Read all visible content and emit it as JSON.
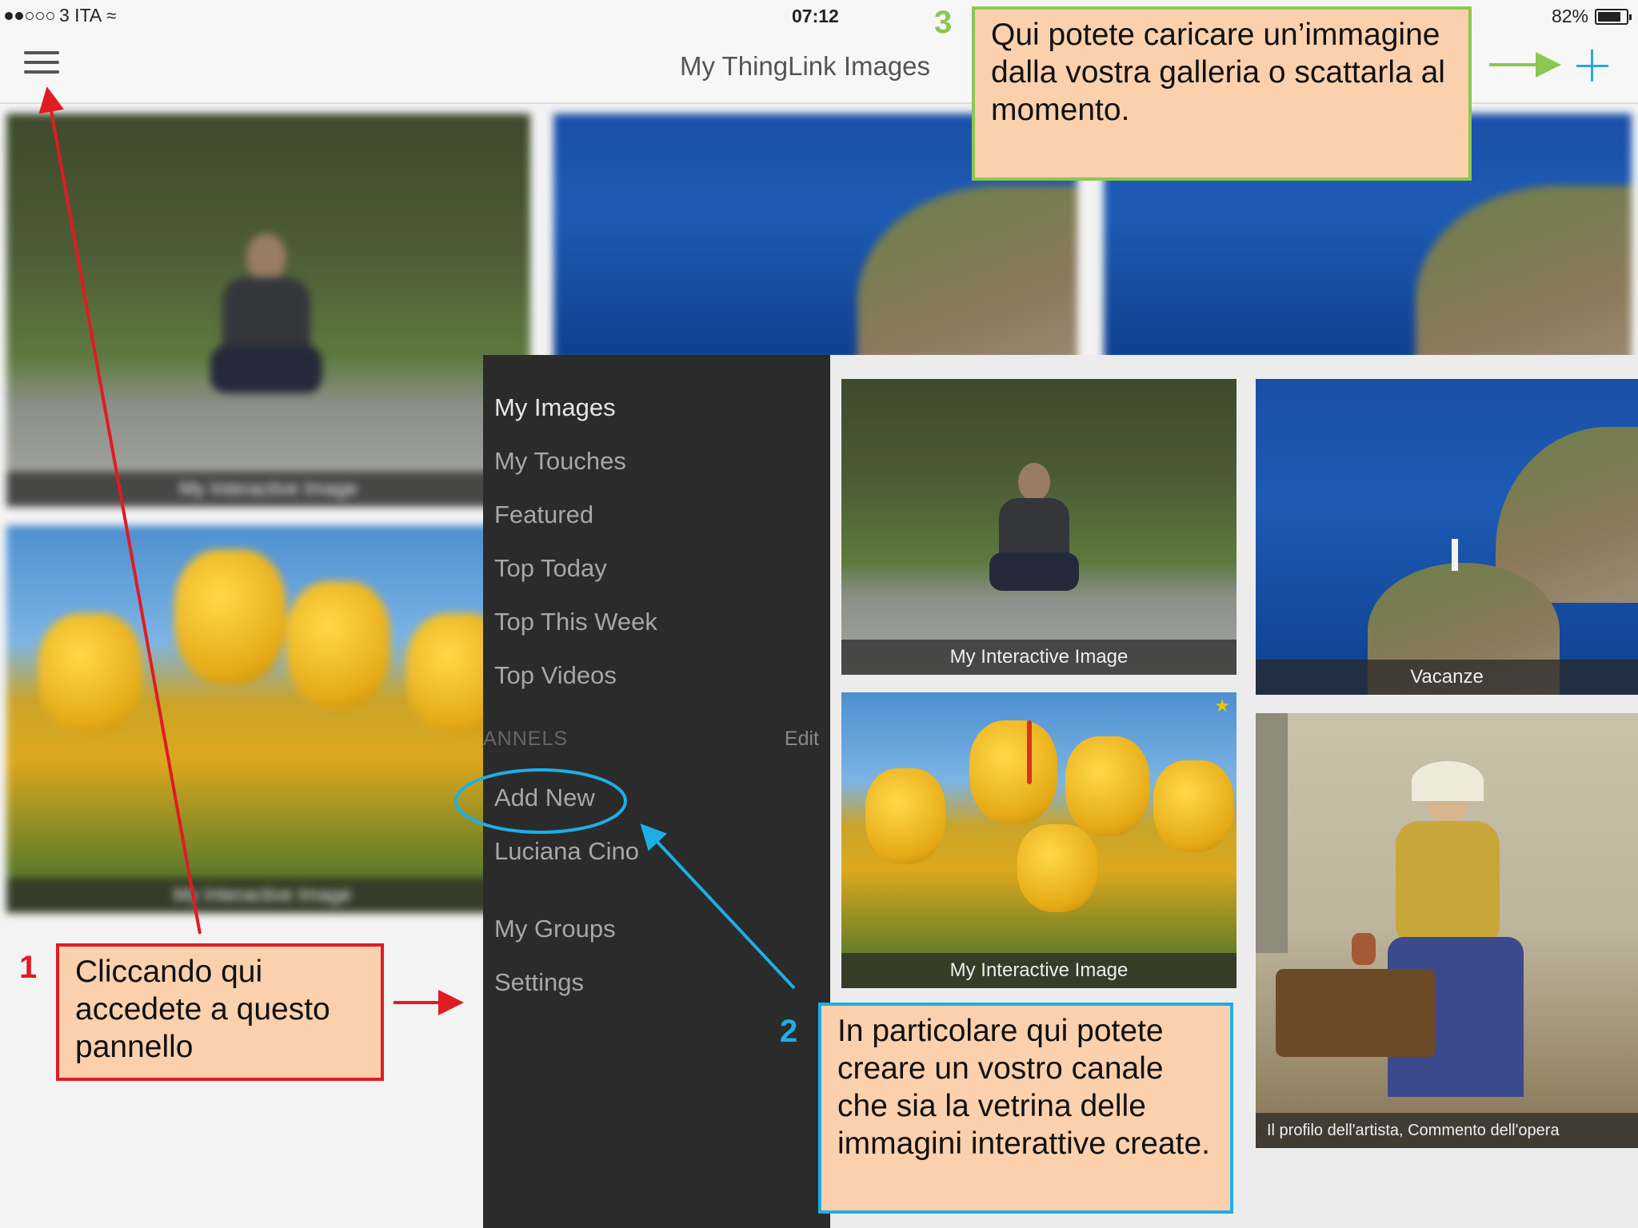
{
  "status_bar": {
    "carrier": "3 ITA",
    "time": "07:12",
    "battery_text": "82%",
    "battery_level": 0.82
  },
  "nav": {
    "title": "My ThingLink Images",
    "menu_icon": "hamburger-icon",
    "add_icon": "plus-icon",
    "accent_color": "#29a9d8"
  },
  "background_tiles": {
    "boy_caption": "My Interactive Image",
    "tulips_caption": "My Interactive Image"
  },
  "panel": {
    "items": [
      "My Images",
      "My Touches",
      "Featured",
      "Top Today",
      "Top This Week",
      "Top Videos"
    ],
    "section_label": "ANNELS",
    "edit_label": "Edit",
    "channel_items": [
      "Add New",
      "Luciana Cino"
    ],
    "footer_items": [
      "My Groups",
      "Settings"
    ]
  },
  "gallery": {
    "tiles": [
      {
        "caption": "My Interactive Image"
      },
      {
        "caption": "Vacanze"
      },
      {
        "caption": "My Interactive Image"
      },
      {
        "caption": "Il profilo dell'artista, Commento dell'opera"
      }
    ]
  },
  "annotations": {
    "one": {
      "number": "1",
      "text": "Cliccando qui accedete a questo pannello",
      "color": "#e11b22"
    },
    "two": {
      "number": "2",
      "text": "In particolare qui potete creare un vostro canale che sia la vetrina delle immagini interattive create.",
      "color": "#1eaee6"
    },
    "three": {
      "number": "3",
      "text": "Qui potete caricare un’immagine dalla vostra galleria o scattarla al momento.",
      "color": "#8cc751"
    }
  }
}
